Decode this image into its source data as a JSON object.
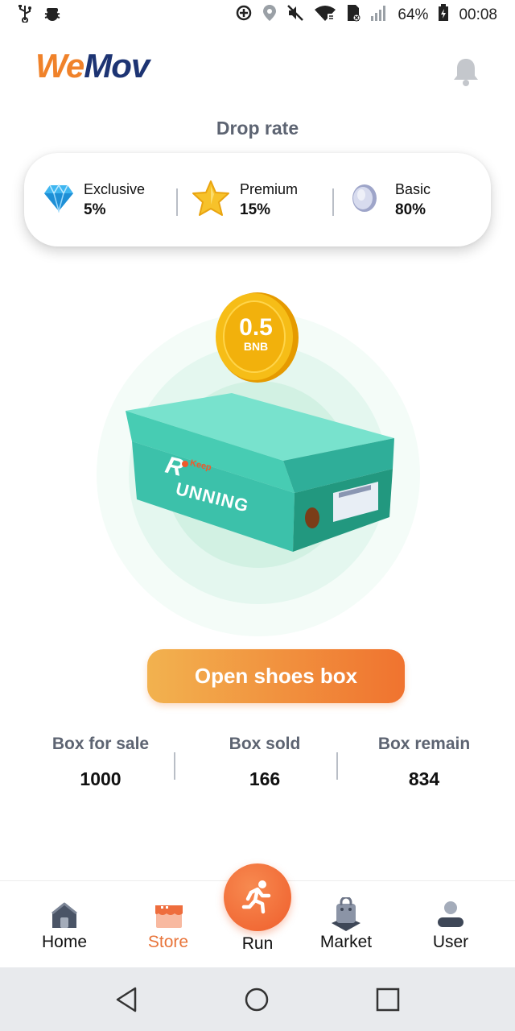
{
  "status_bar": {
    "battery": "64%",
    "time": "00:08"
  },
  "header": {
    "logo_part1": "We",
    "logo_part2": "Mov"
  },
  "drop_rate": {
    "title": "Drop rate",
    "tiers": [
      {
        "name": "Exclusive",
        "value": "5%",
        "icon": "diamond-icon"
      },
      {
        "name": "Premium",
        "value": "15%",
        "icon": "star-icon"
      },
      {
        "name": "Basic",
        "value": "80%",
        "icon": "silver-coin-icon"
      }
    ]
  },
  "box": {
    "price_amount": "0.5",
    "price_currency": "BNB",
    "box_brand_small": "Keep",
    "box_brand": "UNNING"
  },
  "open_button": "Open shoes box",
  "stats": [
    {
      "label": "Box for sale",
      "value": "1000"
    },
    {
      "label": "Box sold",
      "value": "166"
    },
    {
      "label": "Box remain",
      "value": "834"
    }
  ],
  "bottom_nav": {
    "items": [
      {
        "label": "Home",
        "icon": "home-icon"
      },
      {
        "label": "Store",
        "icon": "store-icon",
        "active": true
      },
      {
        "label": "Run",
        "icon": "runner-icon"
      },
      {
        "label": "Market",
        "icon": "shopping-bag-icon"
      },
      {
        "label": "User",
        "icon": "user-icon"
      }
    ]
  },
  "colors": {
    "accent": "#f0732f",
    "accent_light": "#f2b24f",
    "logo_orange": "#f0822a",
    "logo_navy": "#1d3473",
    "box_teal": "#3ec9b0",
    "coin_gold": "#f5b800"
  }
}
